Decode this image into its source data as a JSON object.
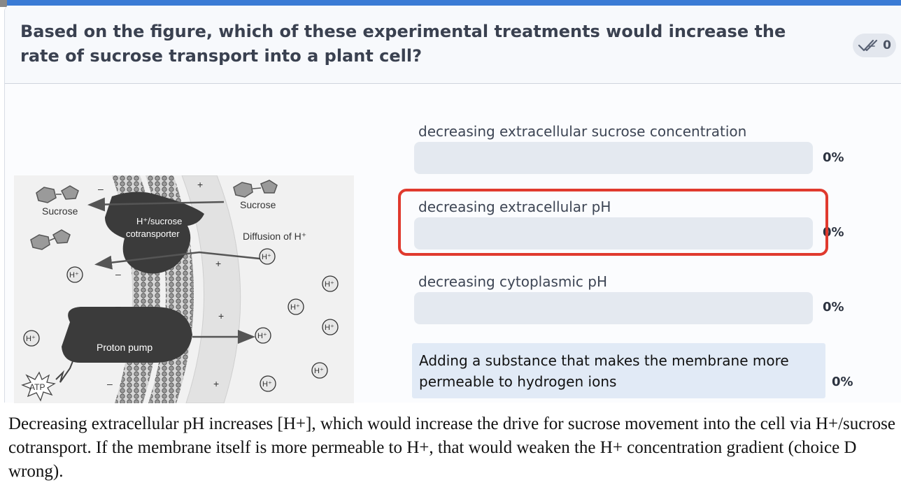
{
  "question": {
    "title": "Based on the figure, which of these experimental treatments would increase the rate of sucrose transport into a plant cell?",
    "answer_count": "0"
  },
  "figure": {
    "labels": {
      "sucrose_left": "Sucrose",
      "sucrose_top": "Sucrose",
      "cotransporter_line1": "H⁺/sucrose",
      "cotransporter_line2": "cotransporter",
      "diffusion": "Diffusion of H⁺",
      "proton_pump": "Proton pump",
      "atp": "ATP",
      "h_ion": "H⁺"
    }
  },
  "options": [
    {
      "label": "decreasing extracellular sucrose concentration",
      "percent": "0%",
      "percent_value": 0
    },
    {
      "label": "decreasing extracellular pH",
      "percent": "0%",
      "percent_value": 0
    },
    {
      "label": "decreasing cytoplasmic pH",
      "percent": "0%",
      "percent_value": 0
    },
    {
      "label": "Adding a substance that makes the membrane more permeable to hydrogen ions",
      "percent": "0%",
      "percent_value": 0
    }
  ],
  "explanation": "Decreasing extracellular pH increases [H+], which would increase the drive for sucrose movement into the cell via H+/sucrose cotransport. If the membrane itself is more permeable to H+, that would weaken the H+ concentration gradient (choice D wrong).",
  "colors": {
    "accent": "#3a7bd5",
    "highlight": "#e03a2e",
    "bar": "#e4e9f0"
  }
}
